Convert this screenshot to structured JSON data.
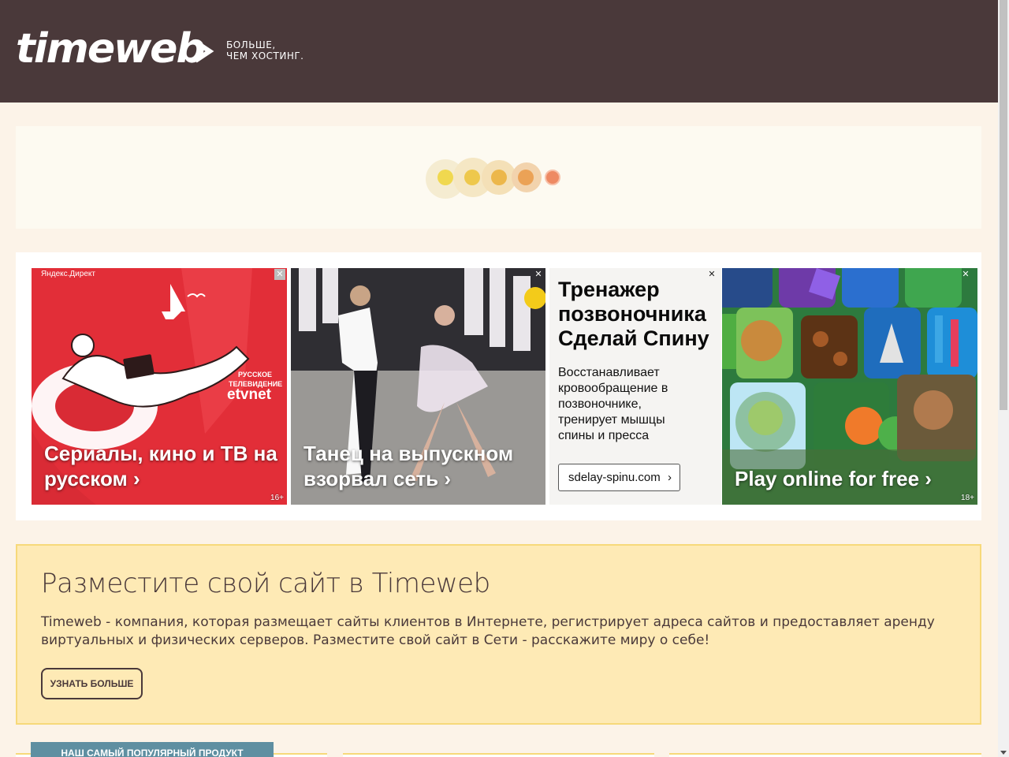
{
  "header": {
    "logo_text": "timeweb",
    "tagline_line1": "БОЛЬШЕ,",
    "tagline_line2": "ЧЕМ ХОСТИНГ."
  },
  "loader": {
    "dot_colors": [
      "#f0d84f",
      "#eec84c",
      "#ecb74b",
      "#eba256",
      "#ee8a63"
    ]
  },
  "ads": {
    "label": "Яндекс.Директ",
    "items": [
      {
        "title": "Сериалы, кино и ТВ на русском ›",
        "age": "16+",
        "brand_line1": "РУССКОЕ",
        "brand_line2": "ТЕЛЕВИДЕНИЕ",
        "brand_logo": "etvnet"
      },
      {
        "title": "Танец на выпускном взорвал сеть ›"
      },
      {
        "title": "Тренажер позвоночника Сделай Спину",
        "body": "Восстанавливает кровообращение в позвоночнике, тренирует мышцы спины и пресса",
        "link": "sdelay-spinu.com"
      },
      {
        "title": "Play online for free ›",
        "age": "18+"
      }
    ],
    "close_symbol": "✕"
  },
  "promo": {
    "title": "Разместите свой сайт в Timeweb",
    "text": "Timeweb - компания, которая размещает сайты клиентов в Интернете, регистрирует адреса сайтов и предоставляет аренду виртуальных и физических серверов. Разместите свой сайт в Сети - расскажите миру о себе!",
    "button": "УЗНАТЬ БОЛЬШЕ"
  },
  "products": {
    "popular_label": "НАШ САМЫЙ ПОПУЛЯРНЫЙ ПРОДУКТ"
  },
  "colors": {
    "header_bg": "#4a393a",
    "page_bg": "#fcf3e8",
    "promo_bg": "#feeab5",
    "accent_tab": "#5f8fa1"
  }
}
